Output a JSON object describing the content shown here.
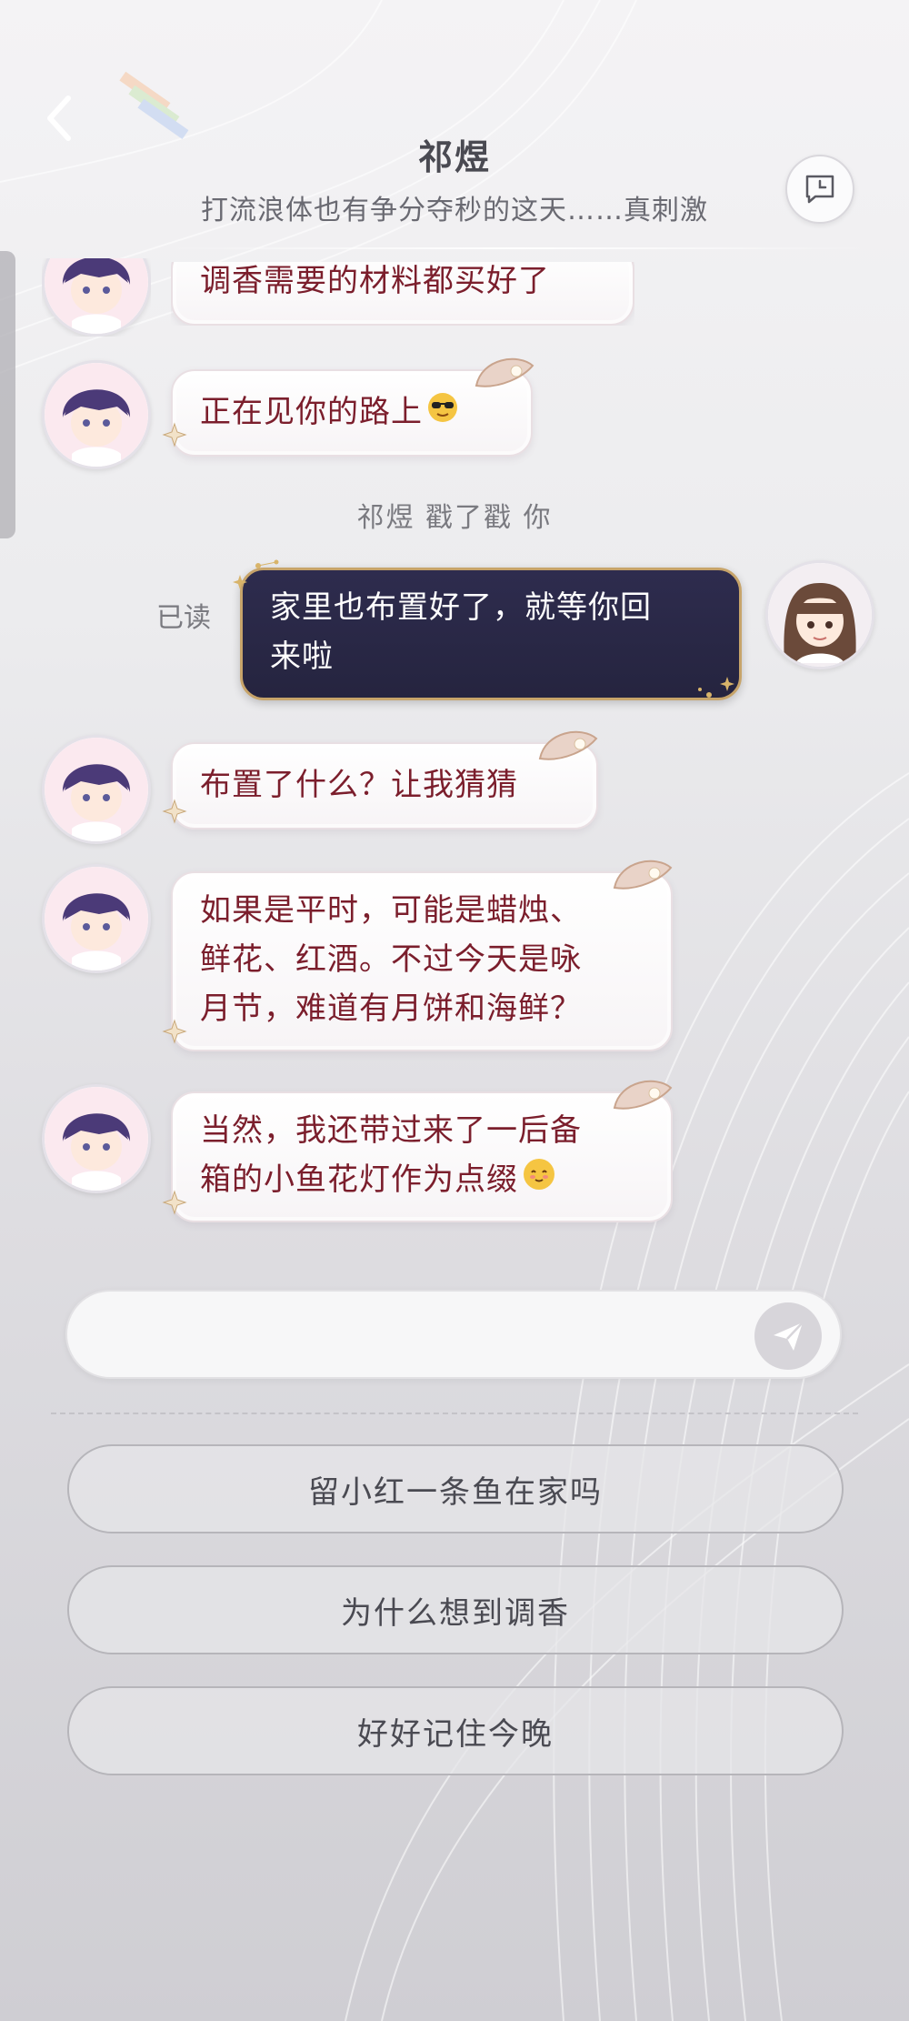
{
  "header": {
    "title": "祁煜",
    "subtitle": "打流浪体也有争分夺秒的这天……真刺激"
  },
  "messages": [
    {
      "sender": "祁煜",
      "text": "调香需要的材料都买好了"
    },
    {
      "sender": "祁煜",
      "text": "正在见你的路上",
      "emoji": "sunglasses-emoji"
    },
    {
      "sender": "me",
      "text": "家里也布置好了，就等你回\n来啦",
      "status": "已读"
    },
    {
      "sender": "祁煜",
      "text": "布置了什么？让我猜猜"
    },
    {
      "sender": "祁煜",
      "text": "如果是平时，可能是蜡烛、\n鲜花、红酒。不过今天是咏\n月节，难道有月饼和海鲜？"
    },
    {
      "sender": "祁煜",
      "text": "当然，我还带过来了一后备\n箱的小鱼花灯作为点缀",
      "emoji": "happy-emoji"
    }
  ],
  "poke": "祁煜 戳了戳 你",
  "input": {
    "value": "",
    "send_icon": "paper-plane-icon"
  },
  "options": [
    "留小红一条鱼在家吗",
    "为什么想到调香",
    "好好记住今晚"
  ],
  "colors": {
    "bubble_text": "#7b1e2c",
    "my_bubble": "#2e2c4e",
    "gold": "#c7a46a"
  }
}
